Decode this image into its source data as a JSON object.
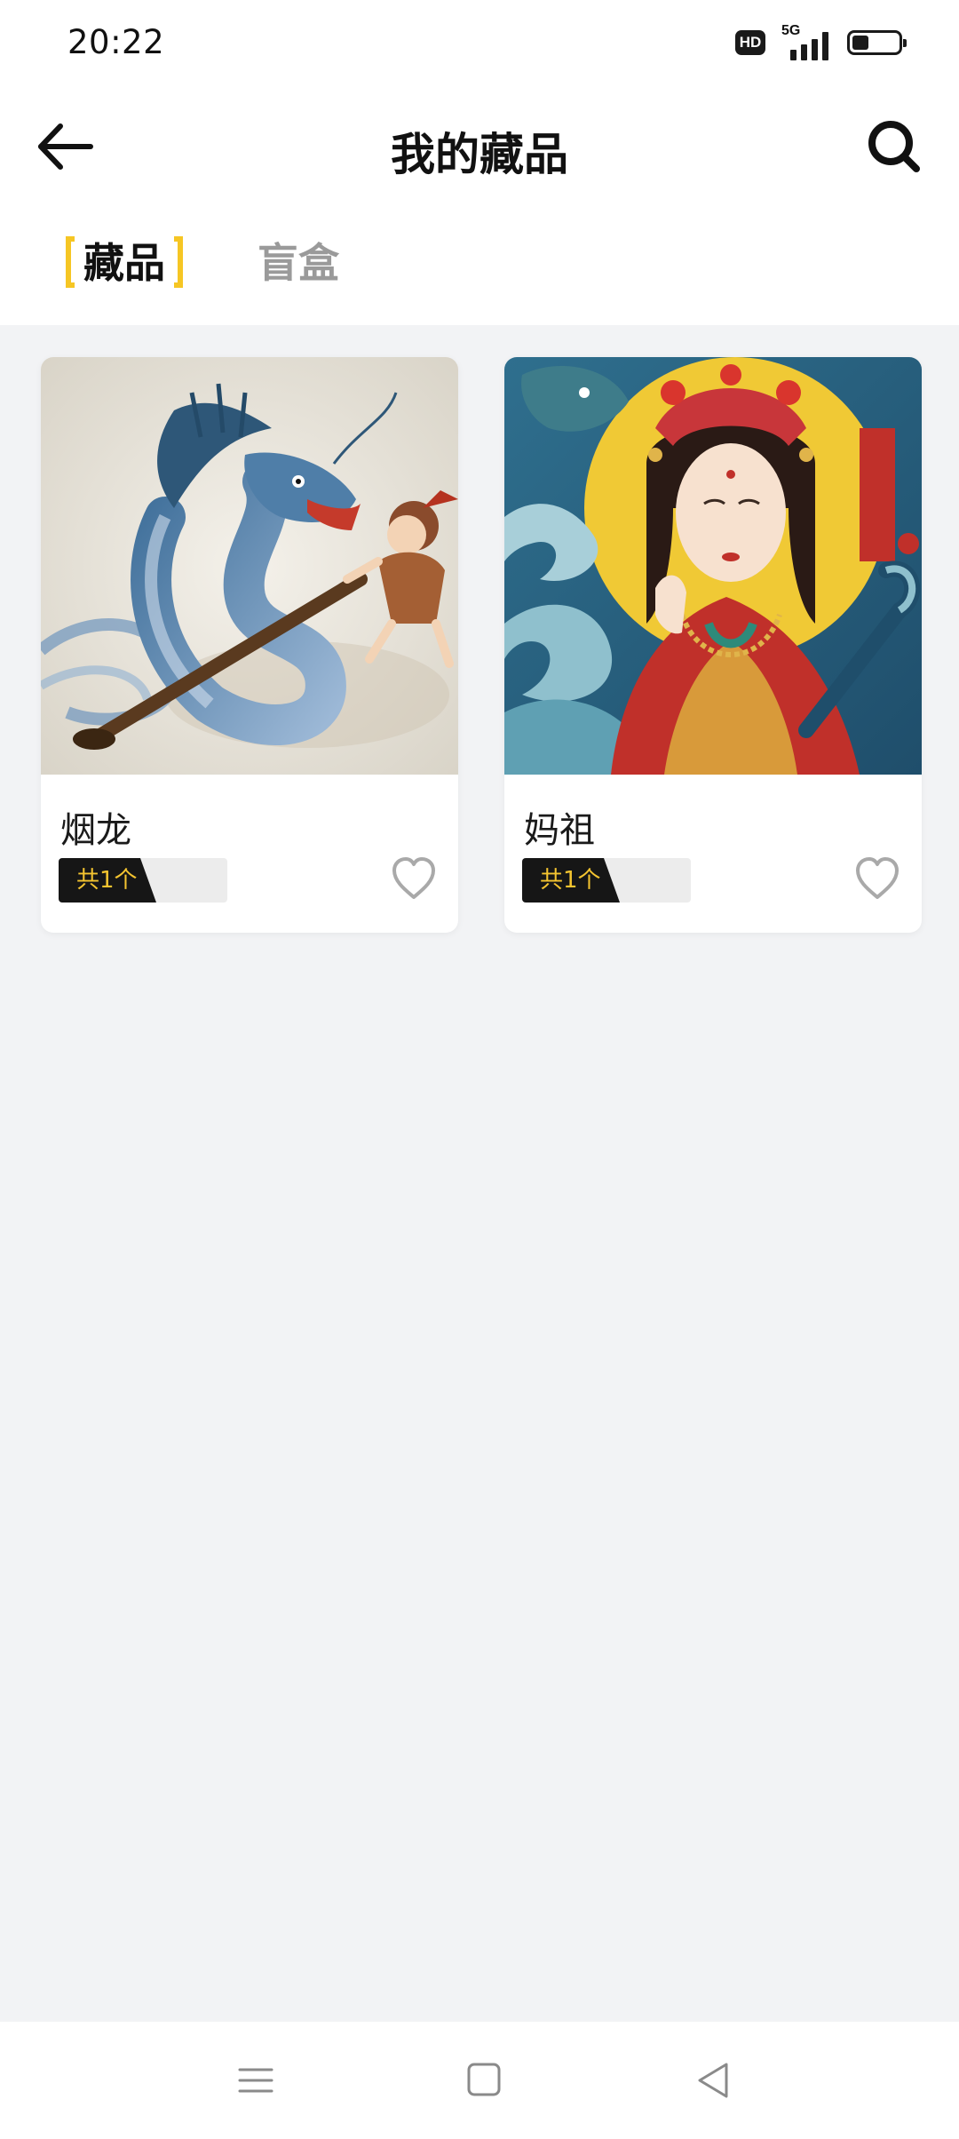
{
  "status_bar": {
    "time": "20:22",
    "hd_label": "HD",
    "network_label": "5G",
    "battery_level": 0.35
  },
  "header": {
    "title": "我的藏品",
    "back_icon": "arrow-left-icon",
    "search_icon": "search-icon"
  },
  "tabs": [
    {
      "label": "藏品",
      "active": true
    },
    {
      "label": "盲盒",
      "active": false
    }
  ],
  "colors": {
    "accent_yellow": "#f6c624",
    "count_text": "#f4c430",
    "background": "#f2f3f5"
  },
  "collection": [
    {
      "name": "烟龙",
      "count_label": "共1个",
      "favorite_icon": "heart-outline-icon",
      "image": "blue-dragon-with-smoking-pipe-illustration"
    },
    {
      "name": "妈祖",
      "count_label": "共1个",
      "favorite_icon": "heart-outline-icon",
      "image": "mazu-goddess-with-dragon-and-waves-illustration"
    }
  ],
  "system_nav": {
    "menu_icon": "menu-icon",
    "home_icon": "square-home-icon",
    "back_icon": "triangle-back-icon"
  }
}
